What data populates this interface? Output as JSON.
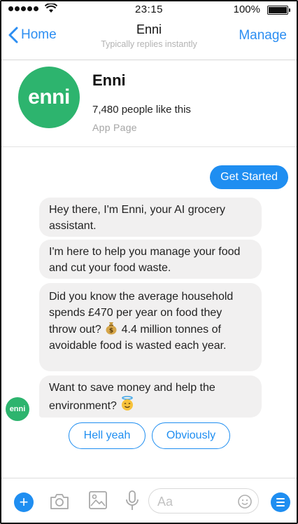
{
  "status_bar": {
    "time": "23:15",
    "battery": "100%"
  },
  "nav": {
    "back_label": "Home",
    "title": "Enni",
    "subtitle": "Typically replies instantly",
    "manage_label": "Manage"
  },
  "page": {
    "logo_text": "enni",
    "name": "Enni",
    "likes": "7,480 people like this",
    "type": "App Page"
  },
  "messages": {
    "outgoing": "Get Started",
    "incoming": [
      "Hey there, I'm Enni, your AI grocery assistant.",
      "I'm here to help you manage your food and cut your food waste.",
      "Did you know the average household spends £470 per year on food they throw out?",
      "4.4 million tonnes of avoidable food is wasted each year.",
      "Want to save money and help the environment?"
    ],
    "avatar_text": "enni"
  },
  "quick_replies": [
    "Hell yeah",
    "Obviously"
  ],
  "composer": {
    "placeholder": "Aa"
  },
  "colors": {
    "accent": "#1f8ef1",
    "brand": "#2db46e",
    "bubble": "#f1f0f0"
  },
  "icons": [
    "signal-icon",
    "wifi-icon",
    "battery-icon",
    "chevron-left-icon",
    "money-bag-icon",
    "halo-face-icon",
    "plus-icon",
    "camera-icon",
    "image-icon",
    "microphone-icon",
    "smiley-icon",
    "menu-icon"
  ]
}
